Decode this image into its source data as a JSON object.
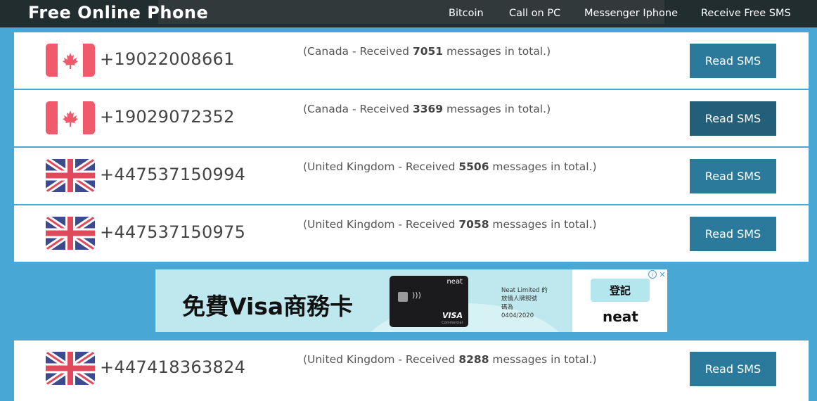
{
  "header": {
    "brand": "Free Online Phone",
    "nav": [
      {
        "label": "Bitcoin"
      },
      {
        "label": "Call on PC"
      },
      {
        "label": "Messenger Iphone"
      },
      {
        "label": "Receive Free SMS"
      }
    ]
  },
  "numbers": [
    {
      "flag": "canada-flag-icon",
      "phone": "+19022008661",
      "prefix": "(Canada - Received ",
      "count": "7051",
      "suffix": " messages in total.)",
      "button": "Read SMS"
    },
    {
      "flag": "canada-flag-icon",
      "phone": "+19029072352",
      "prefix": "(Canada - Received ",
      "count": "3369",
      "suffix": " messages in total.)",
      "button": "Read SMS"
    },
    {
      "flag": "uk-flag-icon",
      "phone": "+447537150994",
      "prefix": "(United Kingdom - Received ",
      "count": "5506",
      "suffix": " messages in total.)",
      "button": "Read SMS"
    },
    {
      "flag": "uk-flag-icon",
      "phone": "+447537150975",
      "prefix": "(United Kingdom - Received ",
      "count": "7058",
      "suffix": " messages in total.)",
      "button": "Read SMS"
    },
    {
      "flag": "uk-flag-icon",
      "phone": "+447418363824",
      "prefix": "(United Kingdom - Received ",
      "count": "8288",
      "suffix": " messages in total.)",
      "button": "Read SMS"
    }
  ],
  "ad": {
    "headline": "免費Visa商務卡",
    "card_brand": "neat",
    "card_network": "VISA",
    "card_sub": "Commercial",
    "legal_lines": [
      "Neat Limited 的",
      "放債人牌照號",
      "碼為",
      "0404/2020"
    ],
    "signup": "登記",
    "logo": "neat",
    "adchoices_icon": "i",
    "close_icon": "✕"
  },
  "colors": {
    "page_bg": "#49a7d5",
    "topbar_bg": "#222d30",
    "button_bg": "#2b7a9b",
    "button_active_bg": "#235f78"
  }
}
